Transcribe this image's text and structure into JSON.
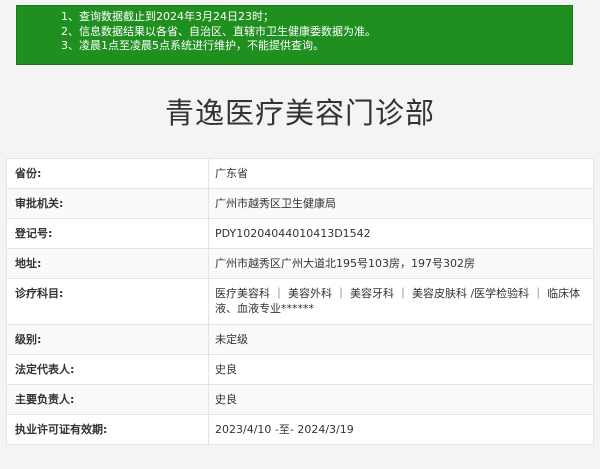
{
  "notice": {
    "lines": [
      "1、查询数据截止到2024年3月24日23时；",
      "2、信息数据结果以各省、自治区、直辖市卫生健康委数据为准。",
      "3、凌晨1点至凌晨5点系统进行维护，不能提供查询。"
    ],
    "background_color": "#1f8f20"
  },
  "page": {
    "title": "青逸医疗美容门诊部"
  },
  "details": [
    {
      "label": "省份:",
      "value": "广东省"
    },
    {
      "label": "审批机关:",
      "value": "广州市越秀区卫生健康局"
    },
    {
      "label": "登记号:",
      "value": "PDY10204044010413D1542"
    },
    {
      "label": "地址:",
      "value": "广州市越秀区广州大道北195号103房，197号302房"
    },
    {
      "label": "诊疗科目:",
      "value": "医疗美容科 ｜ 美容外科 ｜ 美容牙科 ｜ 美容皮肤科 /医学检验科 ｜ 临床体液、血液专业******"
    },
    {
      "label": "级别:",
      "value": "未定级"
    },
    {
      "label": "法定代表人:",
      "value": "史良"
    },
    {
      "label": "主要负责人:",
      "value": "史良"
    },
    {
      "label": "执业许可证有效期:",
      "value": "2023/4/10 -至- 2024/3/19"
    }
  ]
}
